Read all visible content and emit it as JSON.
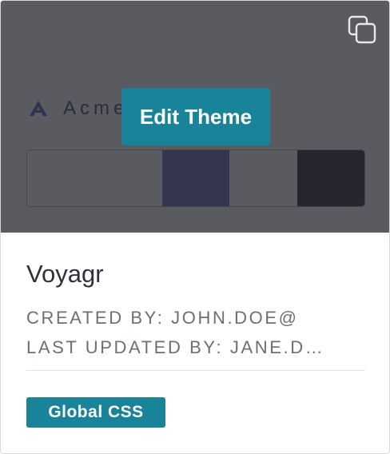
{
  "preview": {
    "brand_name": "Acme",
    "edit_button_label": "Edit Theme",
    "copy_icon": "copy-icon",
    "palette": [
      "#5a5a61",
      "#5a5a61",
      "#34354f",
      "#5a5a61",
      "#25262f"
    ]
  },
  "info": {
    "theme_name": "Voyagr",
    "created_by": "CREATED BY: JOHN.DOE@",
    "last_updated_by": "LAST UPDATED BY: JANE.D…",
    "badge_label": "Global CSS"
  },
  "colors": {
    "accent": "#188399",
    "overlay": "#5a5a61"
  }
}
